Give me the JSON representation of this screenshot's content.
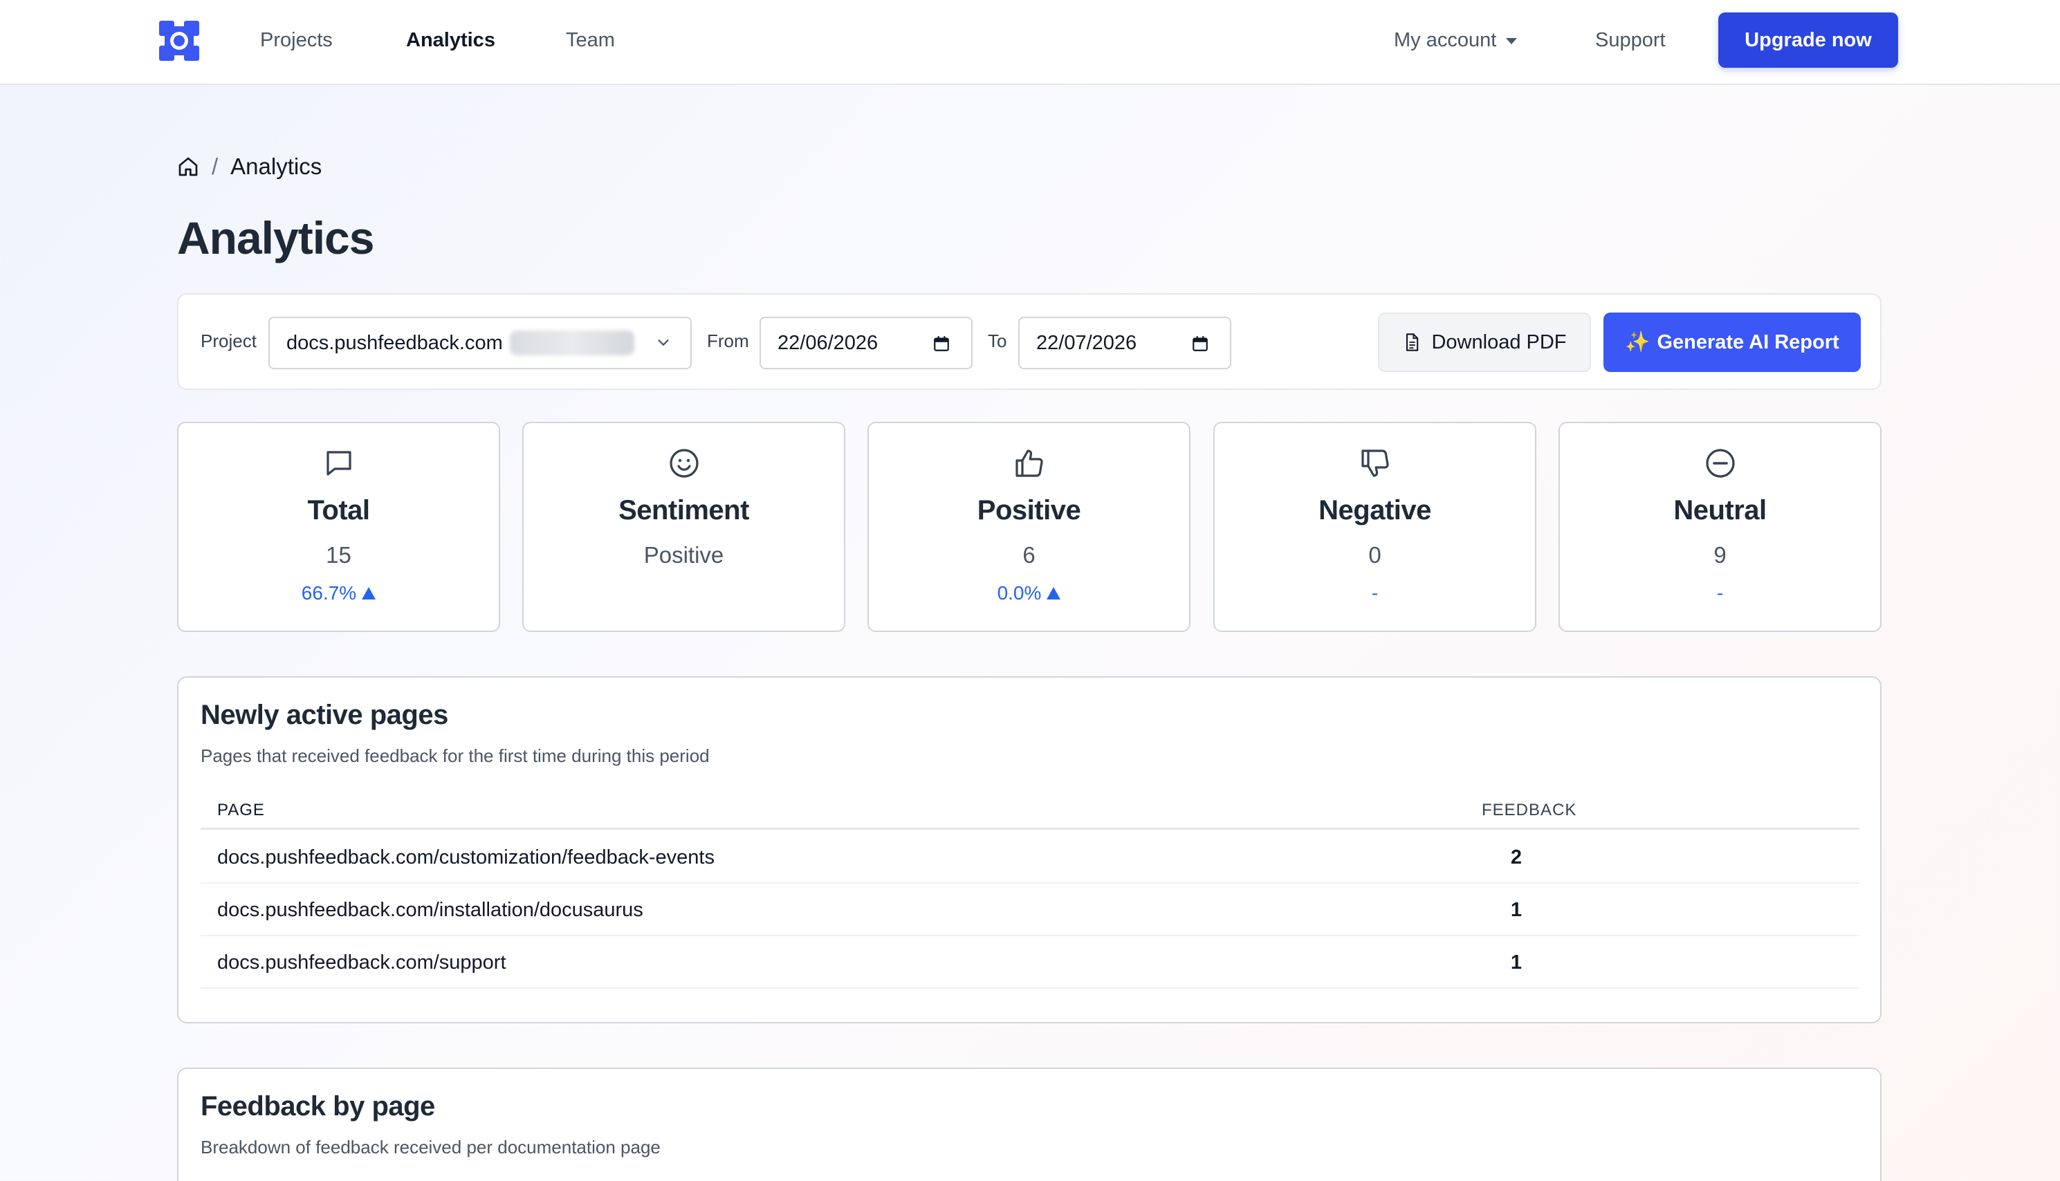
{
  "nav": {
    "links": [
      "Projects",
      "Analytics",
      "Team"
    ],
    "active": "Analytics",
    "account_label": "My account",
    "support_label": "Support",
    "upgrade_label": "Upgrade now",
    "brand_color": "#2b45e0"
  },
  "breadcrumb": {
    "current": "Analytics"
  },
  "page_title": "Analytics",
  "filters": {
    "project_label": "Project",
    "project_value": "docs.pushfeedback.com",
    "from_label": "From",
    "from_value": "22/06/2026",
    "to_label": "To",
    "to_value": "22/07/2026",
    "download_label": "Download PDF",
    "generate_icon": "✨",
    "generate_label": "Generate AI Report"
  },
  "stats": [
    {
      "icon": "chat-bubble-icon",
      "title": "Total",
      "value": "15",
      "change": "66.7%",
      "trend": "up"
    },
    {
      "icon": "smiley-icon",
      "title": "Sentiment",
      "value": "Positive",
      "change": "",
      "trend": ""
    },
    {
      "icon": "thumbs-up-icon",
      "title": "Positive",
      "value": "6",
      "change": "0.0%",
      "trend": "up"
    },
    {
      "icon": "thumbs-down-icon",
      "title": "Negative",
      "value": "0",
      "change": "-",
      "trend": ""
    },
    {
      "icon": "minus-circle-icon",
      "title": "Neutral",
      "value": "9",
      "change": "-",
      "trend": ""
    }
  ],
  "newly_active": {
    "title": "Newly active pages",
    "subtitle": "Pages that received feedback for the first time during this period",
    "col_page": "PAGE",
    "col_feedback": "FEEDBACK",
    "rows": [
      {
        "page": "docs.pushfeedback.com/customization/feedback-events",
        "feedback": "2"
      },
      {
        "page": "docs.pushfeedback.com/installation/docusaurus",
        "feedback": "1"
      },
      {
        "page": "docs.pushfeedback.com/support",
        "feedback": "1"
      }
    ]
  },
  "feedback_by_page": {
    "title": "Feedback by page",
    "subtitle": "Breakdown of feedback received per documentation page"
  },
  "colors": {
    "accent": "#3b57f5",
    "link_blue": "#2563eb"
  }
}
